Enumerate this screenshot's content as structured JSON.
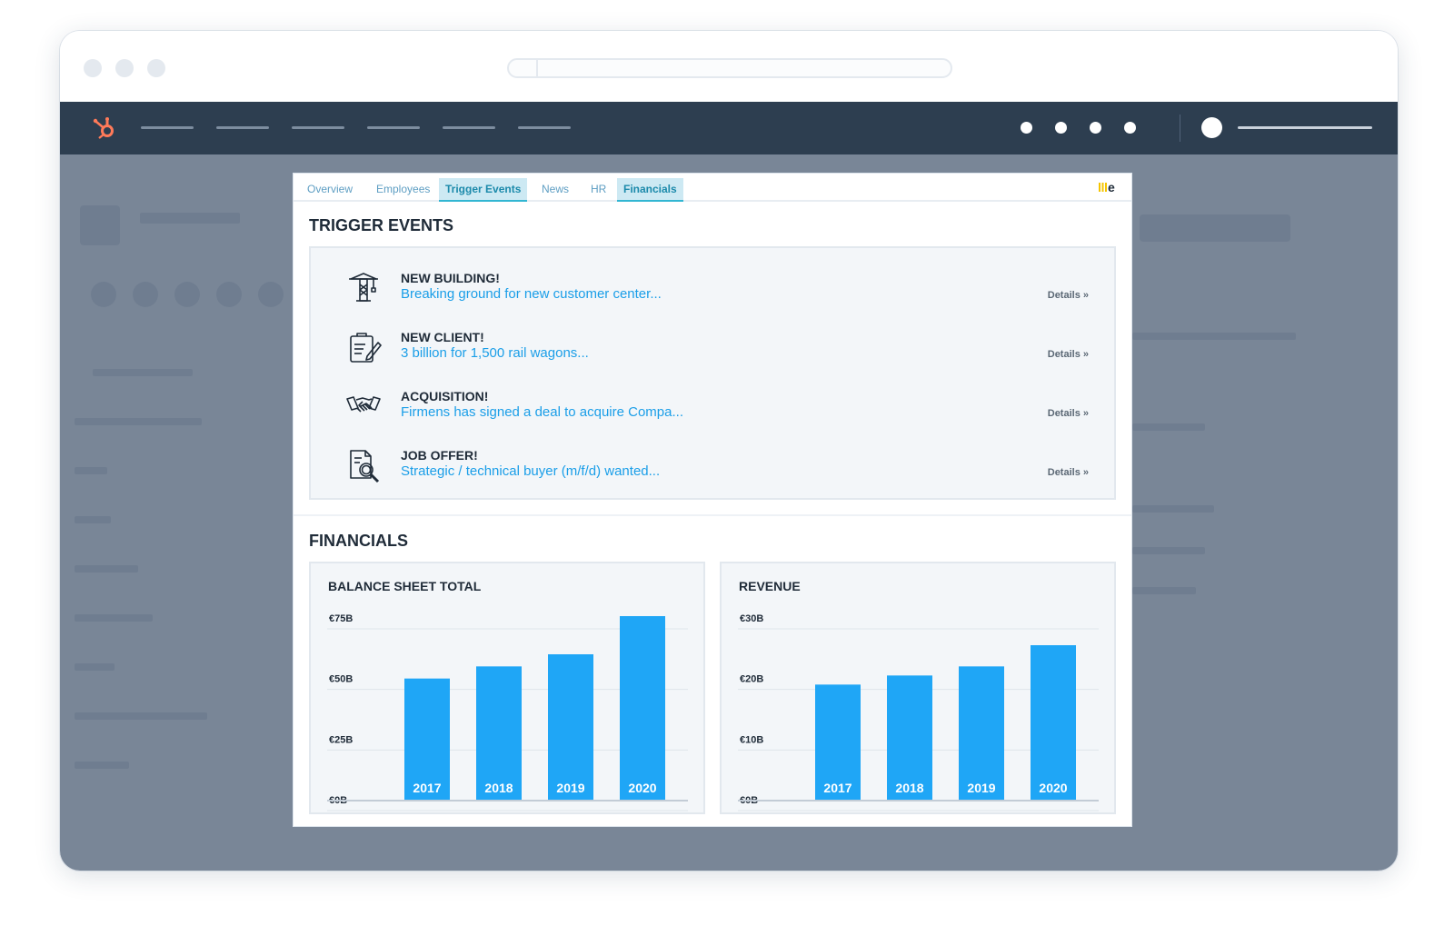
{
  "modal": {
    "tabs": [
      {
        "label": "Overview"
      },
      {
        "label": "Employees"
      },
      {
        "label": "Trigger Events"
      },
      {
        "label": "News"
      },
      {
        "label": "HR"
      },
      {
        "label": "Financials"
      }
    ],
    "trigger_events_title": "TRIGGER EVENTS",
    "events": [
      {
        "title": "NEW BUILDING!",
        "link": "Breaking ground for new customer center...",
        "details": "Details »",
        "icon": "crane-icon"
      },
      {
        "title": "NEW CLIENT!",
        "link": "3 billion for 1,500 rail wagons...",
        "details": "Details »",
        "icon": "clipboard-icon"
      },
      {
        "title": "ACQUISITION!",
        "link": "Firmens has signed a deal to acquire Compa...",
        "details": "Details »",
        "icon": "handshake-icon"
      },
      {
        "title": "JOB OFFER!",
        "link": "Strategic / technical buyer (m/f/d) wanted...",
        "details": "Details »",
        "icon": "document-search-icon"
      }
    ],
    "financials_title": "FINANCIALS"
  },
  "chart_data": [
    {
      "type": "bar",
      "title": "BALANCE SHEET TOTAL",
      "categories": [
        "2017",
        "2018",
        "2019",
        "2020"
      ],
      "values": [
        50,
        55,
        60,
        82
      ],
      "ylim": [
        0,
        75
      ],
      "yticks": [
        "€0B",
        "€25B",
        "€50B",
        "€75B"
      ],
      "ytick_values": [
        0,
        25,
        50,
        75
      ],
      "grid": true,
      "color": "#1fa6f6"
    },
    {
      "type": "bar",
      "title": "REVENUE",
      "categories": [
        "2017",
        "2018",
        "2019",
        "2020"
      ],
      "values": [
        19,
        20.5,
        22,
        25.5
      ],
      "ylim": [
        0,
        30
      ],
      "yticks": [
        "€0B",
        "€10B",
        "€20B",
        "€30B"
      ],
      "ytick_values": [
        0,
        10,
        20,
        30
      ],
      "grid": true,
      "color": "#1fa6f6"
    }
  ]
}
